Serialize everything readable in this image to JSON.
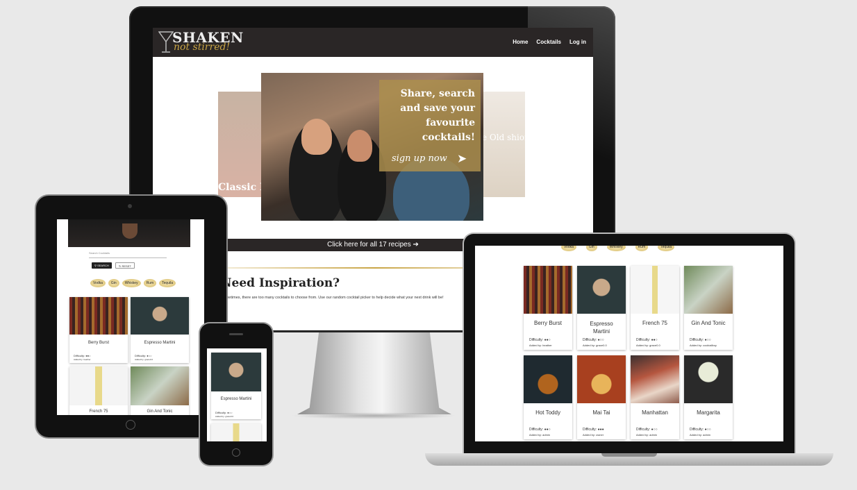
{
  "site": {
    "logo_top": "SHAKEN",
    "logo_bottom": "not stirred!",
    "nav": [
      "Home",
      "Cocktails",
      "Log in"
    ]
  },
  "desktop": {
    "hero_left_text": "Classic M",
    "hero_right_text": "e Old shioned",
    "hero_title": "Share, search and save your favourite cocktails!",
    "hero_cta": "sign up now",
    "recipes_bar": "Click here for all 17 recipes",
    "inspiration_title": "Need Inspiration?",
    "inspiration_text": "Sometimes, there are too many cocktails to choose from. Use our random cocktail picker to help decide what your next drink will be!"
  },
  "tablet": {
    "search_placeholder": "Search Cocktails",
    "search_button": "SEARCH",
    "reset_button": "RESET",
    "chips": [
      "Vodka",
      "Gin",
      "Whiskey",
      "Rum",
      "Tequila"
    ],
    "cards": [
      {
        "name": "Berry Burst",
        "difficulty": "Difficulty: ●●○",
        "added": "Added by: heather"
      },
      {
        "name": "Espresso Martini",
        "difficulty": "Difficulty: ●○○",
        "added": "Added by: grace0.0"
      },
      {
        "name": "French 75",
        "difficulty": "",
        "added": ""
      },
      {
        "name": "Gin And Tonic",
        "difficulty": "",
        "added": ""
      }
    ]
  },
  "phone": {
    "cards": [
      {
        "name": "Espresso Martini",
        "difficulty": "Difficulty: ●○○",
        "added": "Added by: grace0.0"
      }
    ]
  },
  "laptop": {
    "chips": [
      "Vodka",
      "Gin",
      "Whiskey",
      "Rum",
      "Tequila"
    ],
    "cards": [
      {
        "name": "Berry Burst",
        "difficulty": "Difficulty: ●●○",
        "added": "Added by: heather"
      },
      {
        "name": "Espresso Martini",
        "difficulty": "Difficulty: ●○○",
        "added": "Added by: grace0.0"
      },
      {
        "name": "French 75",
        "difficulty": "Difficulty: ●●○",
        "added": "Added by: grace0.0"
      },
      {
        "name": "Gin And Tonic",
        "difficulty": "Difficulty: ●○○",
        "added": "Added by: cocktailboy"
      },
      {
        "name": "Hot Toddy",
        "difficulty": "Difficulty: ●●○",
        "added": "Added by: admin"
      },
      {
        "name": "Mai Tai",
        "difficulty": "Difficulty: ●●●",
        "added": "Added by: owner"
      },
      {
        "name": "Manhattan",
        "difficulty": "Difficulty: ●○○",
        "added": "Added by: admin"
      },
      {
        "name": "Margarita",
        "difficulty": "Difficulty: ●○○",
        "added": "Added by: admin"
      }
    ]
  },
  "colors": {
    "nav_bg": "#2a2626",
    "gold": "#c9a545",
    "page_bg": "#e9e9e9"
  }
}
